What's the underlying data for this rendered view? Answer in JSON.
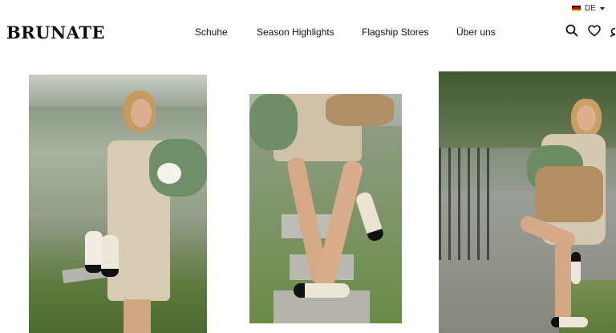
{
  "utility": {
    "language": "DE"
  },
  "header": {
    "logo": "BRUNATE",
    "nav": [
      "Schuhe",
      "Season Highlights",
      "Flagship Stores",
      "Über uns"
    ]
  },
  "icons": [
    "search-icon",
    "heart-icon",
    "account-icon"
  ],
  "colors": {
    "text": "#111111",
    "background": "#ffffff"
  },
  "gallery": [
    "photo-1",
    "photo-2",
    "photo-3"
  ]
}
